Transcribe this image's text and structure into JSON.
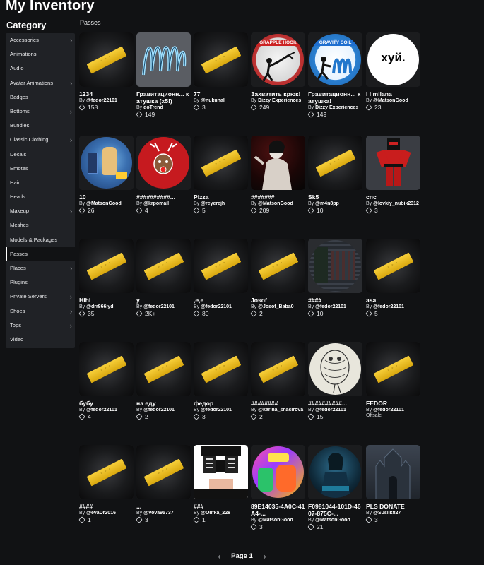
{
  "title": "My Inventory",
  "category_title": "Category",
  "section": "Passes",
  "categories": [
    {
      "label": "Accessories",
      "chev": true
    },
    {
      "label": "Animations",
      "chev": false
    },
    {
      "label": "Audio",
      "chev": false
    },
    {
      "label": "Avatar Animations",
      "chev": true
    },
    {
      "label": "Badges",
      "chev": false
    },
    {
      "label": "Bottoms",
      "chev": true
    },
    {
      "label": "Bundles",
      "chev": false
    },
    {
      "label": "Classic Clothing",
      "chev": true
    },
    {
      "label": "Decals",
      "chev": false
    },
    {
      "label": "Emotes",
      "chev": false
    },
    {
      "label": "Hair",
      "chev": false
    },
    {
      "label": "Heads",
      "chev": false
    },
    {
      "label": "Makeup",
      "chev": true
    },
    {
      "label": "Meshes",
      "chev": false
    },
    {
      "label": "Models & Packages",
      "chev": false
    },
    {
      "label": "Passes",
      "chev": false,
      "active": true
    },
    {
      "label": "Places",
      "chev": true
    },
    {
      "label": "Plugins",
      "chev": false
    },
    {
      "label": "Private Servers",
      "chev": true
    },
    {
      "label": "Shoes",
      "chev": true
    },
    {
      "label": "Tops",
      "chev": true
    },
    {
      "label": "Video",
      "chev": false
    }
  ],
  "items": [
    {
      "name": "1234",
      "by": "By",
      "creator": "@fedor22101",
      "price": "158",
      "thumb": "ticket"
    },
    {
      "name": "Гравитационн... катушка (x5!)",
      "by": "By",
      "creator": "doTrend",
      "price": "149",
      "thumb": "coil"
    },
    {
      "name": "77",
      "by": "By",
      "creator": "@nukunal",
      "price": "3",
      "thumb": "ticket"
    },
    {
      "name": "Захватить крюк!",
      "by": "By",
      "creator": "Dizzy Experiences",
      "price": "249",
      "thumb": "grapple",
      "thumb_text": "GRAPPLE HOOK"
    },
    {
      "name": "Гравитационн... катушка!",
      "by": "By",
      "creator": "Dizzy Experiences",
      "price": "149",
      "thumb": "gravity",
      "thumb_text": "GRAVITY COIL"
    },
    {
      "name": "I I milana",
      "by": "By",
      "creator": "@MatsonGood",
      "price": "23",
      "thumb": "xuy",
      "thumb_text": "хуй."
    },
    {
      "name": "10",
      "by": "By",
      "creator": "@MatsonGood",
      "price": "26",
      "thumb": "game"
    },
    {
      "name": "##########...",
      "by": "By",
      "creator": "@krpomail",
      "price": "4",
      "thumb": "reindeer"
    },
    {
      "name": "Pizza",
      "by": "By",
      "creator": "@reyerejh",
      "price": "5",
      "thumb": "ticket"
    },
    {
      "name": "#######",
      "by": "By",
      "creator": "@MatsonGood",
      "price": "209",
      "thumb": "dark-figure"
    },
    {
      "name": "Sk5",
      "by": "By",
      "creator": "@m4n8pp",
      "price": "10",
      "thumb": "ticket"
    },
    {
      "name": "спс",
      "by": "By",
      "creator": "@lovkiy_nubik2312",
      "price": "3",
      "thumb": "avatar-red"
    },
    {
      "name": "Hihi",
      "by": "By",
      "creator": "@drr866iyd",
      "price": "35",
      "thumb": "ticket"
    },
    {
      "name": "y",
      "by": "By",
      "creator": "@fedor22101",
      "price": "2K+",
      "thumb": "ticket"
    },
    {
      "name": ",e,e",
      "by": "By",
      "creator": "@fedor22101",
      "price": "80",
      "thumb": "ticket"
    },
    {
      "name": "Josof",
      "by": "By",
      "creator": "@Josof_Baba0",
      "price": "2",
      "thumb": "ticket"
    },
    {
      "name": "####",
      "by": "By",
      "creator": "@fedor22101",
      "price": "10",
      "thumb": "screenshot"
    },
    {
      "name": "asa",
      "by": "By",
      "creator": "@fedor22101",
      "price": "5",
      "thumb": "ticket"
    },
    {
      "name": "бубу",
      "by": "By",
      "creator": "@fedor22101",
      "price": "4",
      "thumb": "ticket"
    },
    {
      "name": "на еду",
      "by": "By",
      "creator": "@fedor22101",
      "price": "2",
      "thumb": "ticket"
    },
    {
      "name": "федор",
      "by": "By",
      "creator": "@fedor22101",
      "price": "3",
      "thumb": "ticket"
    },
    {
      "name": "########",
      "by": "By",
      "creator": "@karina_shacirova",
      "price": "2",
      "thumb": "ticket"
    },
    {
      "name": "##########...",
      "by": "By",
      "creator": "@fedor22101",
      "price": "15",
      "thumb": "sketch"
    },
    {
      "name": "FEDOR",
      "by": "By",
      "creator": "@fedor22101",
      "price": "",
      "offsale": "Offsale",
      "thumb": "ticket"
    },
    {
      "name": "####",
      "by": "By",
      "creator": "@evaDr2016",
      "price": "1",
      "thumb": "ticket"
    },
    {
      "name": "...",
      "by": "By",
      "creator": "@Vova95737",
      "price": "3",
      "thumb": "ticket"
    },
    {
      "name": "###",
      "by": "By",
      "creator": "@Olifka_228",
      "price": "1",
      "thumb": "skeleton"
    },
    {
      "name": "89E14035-4A0C-41A4-...",
      "by": "By",
      "creator": "@MatsonGood",
      "price": "3",
      "thumb": "colorful"
    },
    {
      "name": "F0981044-101D-4607-875C-...",
      "by": "By",
      "creator": "@MatsonGood",
      "price": "21",
      "thumb": "blue-dark"
    },
    {
      "name": "PLS DONATE",
      "by": "By",
      "creator": "@Suslik827",
      "price": "3",
      "thumb": "castle"
    }
  ],
  "pager": {
    "label": "Page 1",
    "prev": "‹",
    "next": "›"
  }
}
